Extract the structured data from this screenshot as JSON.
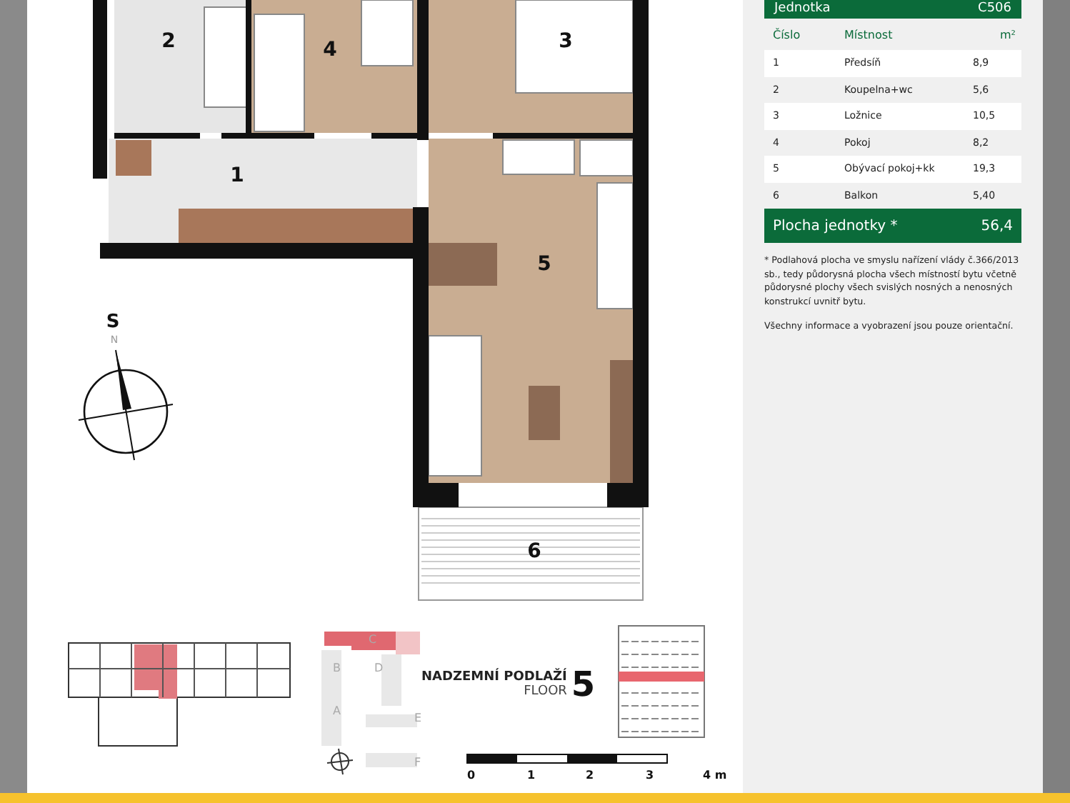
{
  "unit_table": {
    "title": "Jednotka",
    "unit": "C506",
    "columns": [
      "Číslo",
      "Místnost",
      "m²"
    ],
    "rows": [
      {
        "number": "1",
        "room": "Předsíň",
        "area": "8,9"
      },
      {
        "number": "2",
        "room": "Koupelna+wc",
        "area": "5,6"
      },
      {
        "number": "3",
        "room": "Ložnice",
        "area": "10,5"
      },
      {
        "number": "4",
        "room": "Pokoj",
        "area": "8,2"
      },
      {
        "number": "5",
        "room": "Obývací pokoj+kk",
        "area": "19,3"
      },
      {
        "number": "6",
        "room": "Balkon",
        "area": "5,40"
      }
    ],
    "total_label": "Plocha jednotky *",
    "total_value": "56,4"
  },
  "notes": [
    "* Podlahová plocha ve smyslu nařízení vlády č.366/2013 sb., tedy půdorysná plocha všech místností bytu včetně půdorysné plochy všech svislých nosných a nenosných konstrukcí uvnitř bytu.",
    "Všechny informace a vyobrazení jsou pouze orientační."
  ],
  "plan": {
    "rooms": [
      "2",
      "4",
      "3",
      "1",
      "5",
      "6"
    ],
    "compass": {
      "top_label": "S",
      "bottom_label": "N"
    }
  },
  "site_plan": {
    "buildings": [
      "C",
      "B",
      "D",
      "A",
      "E",
      "F"
    ]
  },
  "floor": {
    "label": "NADZEMNÍ PODLAŽÍ",
    "sublabel": "FLOOR",
    "number": "5"
  },
  "scale": [
    "0",
    "1",
    "2",
    "3",
    "4 m"
  ]
}
